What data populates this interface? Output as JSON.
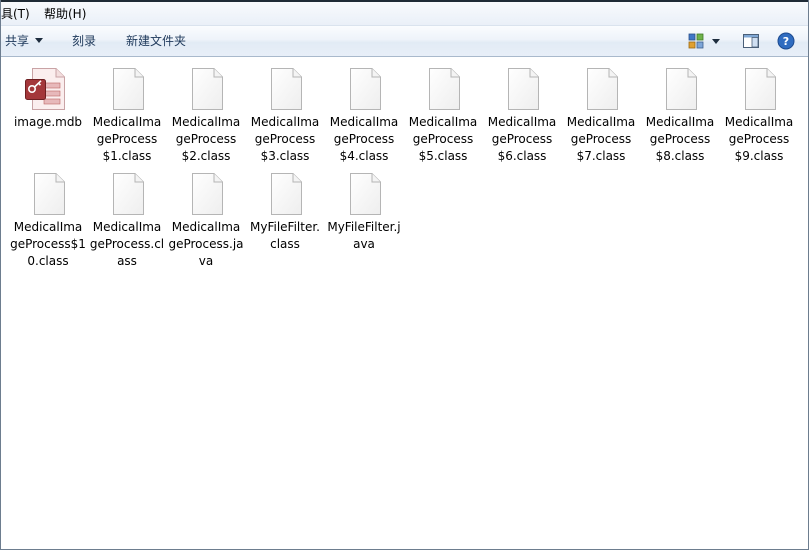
{
  "menu": {
    "tools": "具(T)",
    "help": "帮助(H)"
  },
  "toolbar": {
    "share_label": "共享",
    "burn_label": "刻录",
    "new_folder_label": "新建文件夹",
    "view_icon": "view-options-icon",
    "preview_icon": "preview-pane-icon",
    "help_icon": "help-icon"
  },
  "files": [
    {
      "name": "image.mdb",
      "type": "access"
    },
    {
      "name": "MedicalImageProcess$1.class",
      "type": "blank"
    },
    {
      "name": "MedicalImageProcess$2.class",
      "type": "blank"
    },
    {
      "name": "MedicalImageProcess$3.class",
      "type": "blank"
    },
    {
      "name": "MedicalImageProcess$4.class",
      "type": "blank"
    },
    {
      "name": "MedicalImageProcess$5.class",
      "type": "blank"
    },
    {
      "name": "MedicalImageProcess$6.class",
      "type": "blank"
    },
    {
      "name": "MedicalImageProcess$7.class",
      "type": "blank"
    },
    {
      "name": "MedicalImageProcess$8.class",
      "type": "blank"
    },
    {
      "name": "MedicalImageProcess$9.class",
      "type": "blank"
    },
    {
      "name": "MedicalImageProcess$10.class",
      "type": "blank"
    },
    {
      "name": "MedicalImageProcess.class",
      "type": "blank"
    },
    {
      "name": "MedicalImageProcess.java",
      "type": "blank"
    },
    {
      "name": "MyFileFilter.class",
      "type": "blank"
    },
    {
      "name": "MyFileFilter.java",
      "type": "blank"
    }
  ],
  "colors": {
    "toolbar_text": "#1e395b",
    "access_red": "#a4373a"
  }
}
